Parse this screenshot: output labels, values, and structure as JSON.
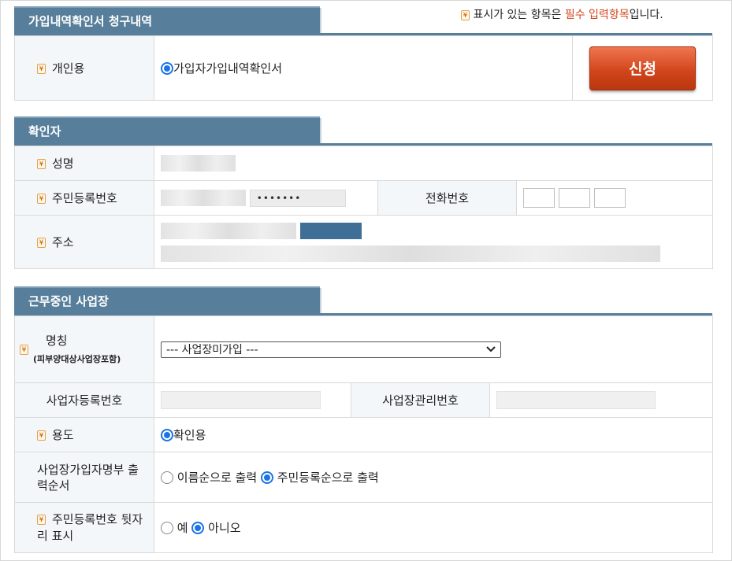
{
  "notice": {
    "icon": "required-mark-icon",
    "prefix": "표시가 있는 항목은 ",
    "highlight": "필수 입력항목",
    "suffix": "입니다."
  },
  "sections": {
    "claim": {
      "title": "가입내역확인서 청구내역",
      "row_label": "개인용",
      "option_label": "가입자가입내역확인서",
      "apply_button": "신청"
    },
    "confirmer": {
      "title": "확인자",
      "name_label": "성명",
      "rrn_label": "주민등록번호",
      "rrn_back_mask": "•••••••",
      "phone_label": "전화번호",
      "address_label": "주소"
    },
    "workplace": {
      "title": "근무중인 사업장",
      "name_label": "명칭",
      "name_sublabel": "(피부양대상사업장포함)",
      "workplace_select_value": "--- 사업장미가입 ---",
      "biz_reg_label": "사업자등록번호",
      "biz_mgmt_label": "사업장관리번호",
      "purpose_label": "용도",
      "purpose_option": "확인용",
      "order_label": "사업장가입자명부 출력순서",
      "order_option_name": "이름순으로 출력",
      "order_option_rrn": "주민등록순으로 출력",
      "rrn_display_label": "주민등록번호 뒷자리 표시",
      "yes_label": "예",
      "no_label": "아니오"
    }
  },
  "colors": {
    "section_header": "#577f9b",
    "accent_red": "#d2461c",
    "radio_blue": "#1a73e8"
  }
}
